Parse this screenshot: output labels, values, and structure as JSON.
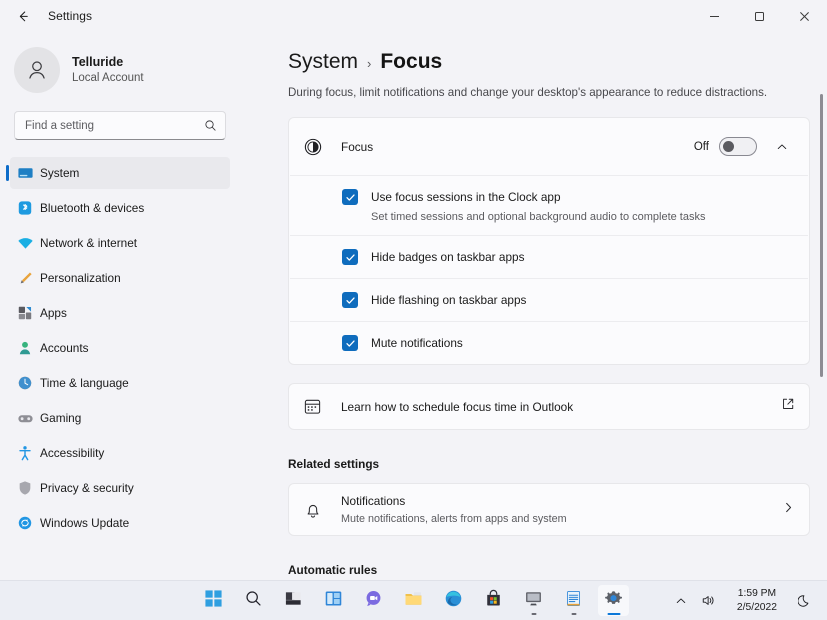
{
  "window": {
    "title": "Settings",
    "back_icon": "arrow-left-icon",
    "minimize_label": "─",
    "maximize_label": "❐",
    "close_label": "✕"
  },
  "account": {
    "name": "Telluride",
    "subtitle": "Local Account",
    "avatar_icon": "person-icon"
  },
  "search": {
    "placeholder": "Find a setting",
    "value": "",
    "icon": "search-icon"
  },
  "sidebar": {
    "items": [
      {
        "label": "System",
        "icon": "monitor-icon",
        "active": true
      },
      {
        "label": "Bluetooth & devices",
        "icon": "bluetooth-icon",
        "active": false
      },
      {
        "label": "Network & internet",
        "icon": "wifi-icon",
        "active": false
      },
      {
        "label": "Personalization",
        "icon": "paintbrush-icon",
        "active": false
      },
      {
        "label": "Apps",
        "icon": "apps-icon",
        "active": false
      },
      {
        "label": "Accounts",
        "icon": "account-icon",
        "active": false
      },
      {
        "label": "Time & language",
        "icon": "clock-globe-icon",
        "active": false
      },
      {
        "label": "Gaming",
        "icon": "gamepad-icon",
        "active": false
      },
      {
        "label": "Accessibility",
        "icon": "accessibility-icon",
        "active": false
      },
      {
        "label": "Privacy & security",
        "icon": "shield-icon",
        "active": false
      },
      {
        "label": "Windows Update",
        "icon": "update-icon",
        "active": false
      }
    ]
  },
  "page": {
    "breadcrumb_parent": "System",
    "breadcrumb_separator": "›",
    "breadcrumb_current": "Focus",
    "description": "During focus, limit notifications and change your desktop's appearance to reduce distractions."
  },
  "focus_card": {
    "icon": "focus-moon-icon",
    "title": "Focus",
    "toggle_state": "Off",
    "toggle_on": false,
    "expand_icon": "chevron-up-icon",
    "expanded": true,
    "options": [
      {
        "label": "Use focus sessions in the Clock app",
        "sublabel": "Set timed sessions and optional background audio to complete tasks",
        "checked": true
      },
      {
        "label": "Hide badges on taskbar apps",
        "sublabel": "",
        "checked": true
      },
      {
        "label": "Hide flashing on taskbar apps",
        "sublabel": "",
        "checked": true
      },
      {
        "label": "Mute notifications",
        "sublabel": "",
        "checked": true
      }
    ]
  },
  "outlook_link": {
    "icon": "calendar-icon",
    "label": "Learn how to schedule focus time in Outlook",
    "external_icon": "external-link-icon"
  },
  "related": {
    "heading": "Related settings",
    "items": [
      {
        "icon": "bell-icon",
        "title": "Notifications",
        "subtitle": "Mute notifications, alerts from apps and system",
        "chevron": "chevron-right-icon"
      }
    ]
  },
  "automatic_rules": {
    "heading": "Automatic rules"
  },
  "taskbar": {
    "icons": [
      {
        "name": "start-icon",
        "state": ""
      },
      {
        "name": "search-icon",
        "state": ""
      },
      {
        "name": "task-view-icon",
        "state": ""
      },
      {
        "name": "widgets-icon",
        "state": ""
      },
      {
        "name": "chat-icon",
        "state": ""
      },
      {
        "name": "file-explorer-icon",
        "state": ""
      },
      {
        "name": "edge-icon",
        "state": ""
      },
      {
        "name": "microsoft-store-icon",
        "state": ""
      },
      {
        "name": "remote-desktop-icon",
        "state": "running"
      },
      {
        "name": "notepad-icon",
        "state": "running"
      },
      {
        "name": "settings-icon",
        "state": "active"
      }
    ],
    "tray": {
      "overflow_icon": "chevron-up-icon",
      "volume_icon": "speaker-icon",
      "time": "1:59 PM",
      "date": "2/5/2022",
      "notification_icon": "moon-icon"
    }
  },
  "colors": {
    "accent": "#0d6cc9",
    "checkbox": "#0f6cbd",
    "app_bg": "#f3f3f7",
    "card_bg": "#fbfbfd",
    "taskbar_bg": "#eceef4"
  }
}
